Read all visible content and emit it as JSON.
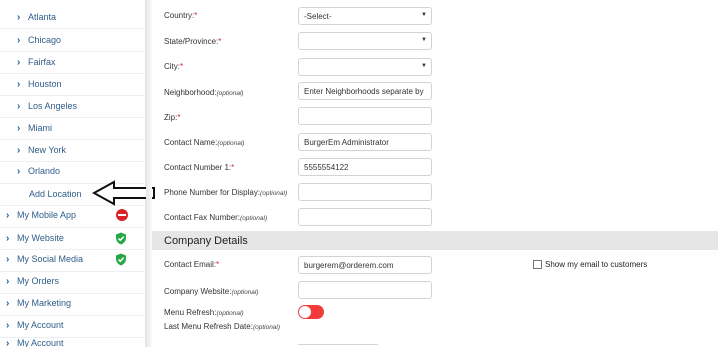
{
  "sidebar": {
    "cities": [
      {
        "label": "Atlanta"
      },
      {
        "label": "Chicago"
      },
      {
        "label": "Fairfax"
      },
      {
        "label": "Houston"
      },
      {
        "label": "Los Angeles"
      },
      {
        "label": "Miami"
      },
      {
        "label": "New York"
      },
      {
        "label": "Orlando"
      }
    ],
    "add_location": "Add Location",
    "menu": [
      {
        "label": "My Mobile App",
        "status": "red-badge"
      },
      {
        "label": "My Website",
        "status": "green-shield"
      },
      {
        "label": "My Social Media",
        "status": "green-shield"
      },
      {
        "label": "My Orders"
      },
      {
        "label": "My Marketing"
      },
      {
        "label": "My Account"
      },
      {
        "label": "My Account"
      }
    ],
    "colors": {
      "link": "#2f5d8a",
      "red": "#d9202b",
      "green": "#27a844"
    }
  },
  "form": {
    "country": {
      "label": "Country:",
      "required": "*",
      "value": "-Select-"
    },
    "state": {
      "label": "State/Province:",
      "required": "*",
      "value": ""
    },
    "city": {
      "label": "City:",
      "required": "*",
      "value": ""
    },
    "neighborhood": {
      "label": "Neighborhood:",
      "optional": "(optional)",
      "value": "Enter Neighborhoods separate by"
    },
    "zip": {
      "label": "Zip:",
      "required": "*",
      "value": ""
    },
    "contact_name": {
      "label": "Contact Name:",
      "optional": "(optional)",
      "value": "BurgerEm Administrator"
    },
    "contact_number": {
      "label": "Contact Number 1:",
      "required": "*",
      "value": "5555554122"
    },
    "phone_display": {
      "label": "Phone Number for Display:",
      "optional": "(optional)",
      "value": ""
    },
    "fax": {
      "label": "Contact Fax Number:",
      "optional": "(optional)",
      "value": ""
    }
  },
  "company": {
    "section_title": "Company Details",
    "email": {
      "label": "Contact Email:",
      "required": "*",
      "value": "burgerem@orderem.com"
    },
    "show_email_label": "Show my email to customers",
    "website": {
      "label": "Company Website:",
      "optional": "(optional)",
      "value": ""
    },
    "menu_refresh": {
      "label": "Menu Refresh:",
      "optional": "(optional)",
      "state": "off"
    },
    "last_refresh": {
      "label": "Last Menu Refresh Date:",
      "optional": "(optional)"
    }
  }
}
